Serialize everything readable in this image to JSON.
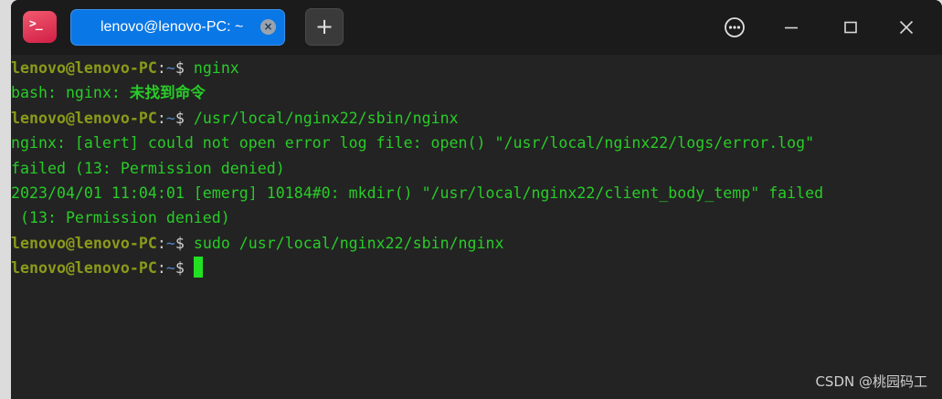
{
  "window": {
    "tab_title": "lenovo@lenovo-PC: ~",
    "tab_close_glyph": "×",
    "new_tab_glyph": "+",
    "app_icon_glyph": ">_"
  },
  "prompt": {
    "user_host": "lenovo@lenovo-PC",
    "sep": ":",
    "path": "~",
    "dollar": "$ "
  },
  "lines": [
    {
      "kind": "prompt",
      "command": "nginx"
    },
    {
      "kind": "output",
      "text": "bash: nginx: ",
      "bold": "未找到命令"
    },
    {
      "kind": "prompt",
      "command": "/usr/local/nginx22/sbin/nginx"
    },
    {
      "kind": "output",
      "text": "nginx: [alert] could not open error log file: open() \"/usr/local/nginx22/logs/error.log\""
    },
    {
      "kind": "output",
      "text": "failed (13: Permission denied)"
    },
    {
      "kind": "output",
      "text": "2023/04/01 11:04:01 [emerg] 10184#0: mkdir() \"/usr/local/nginx22/client_body_temp\" failed"
    },
    {
      "kind": "output",
      "text": " (13: Permission denied)"
    },
    {
      "kind": "prompt",
      "command": "sudo /usr/local/nginx22/sbin/nginx"
    },
    {
      "kind": "prompt",
      "command": "",
      "cursor": true
    }
  ],
  "watermark": "CSDN @桃园码工",
  "colors": {
    "prompt_user": "#8a9a1a",
    "prompt_path": "#4e86c7",
    "output_text": "#28cc28",
    "cursor": "#22e022",
    "tab_active": "#0a77e6",
    "titlebar": "#1b1b1b",
    "terminal_bg": "#232323"
  },
  "icons": {
    "app": "terminal-app-icon",
    "menu": "more-options-icon",
    "minimize": "minimize-icon",
    "maximize": "maximize-icon",
    "close": "close-icon"
  }
}
